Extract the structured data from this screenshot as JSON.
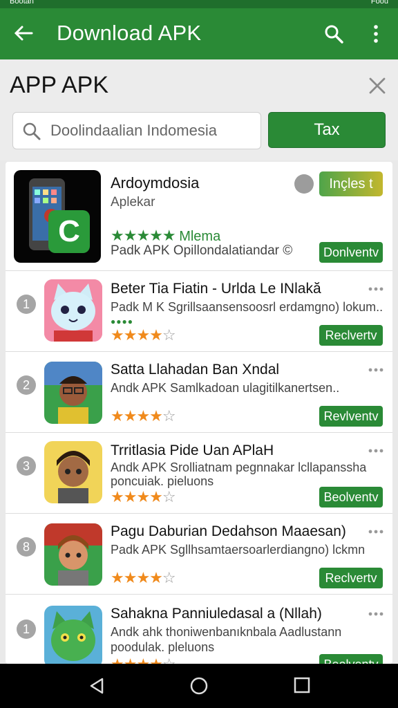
{
  "statusbar": {
    "left": "Bootan",
    "right": "Foou"
  },
  "appbar": {
    "title": "Download APK"
  },
  "header": {
    "title": "APP APK"
  },
  "search": {
    "placeholder": "Doolindaalian Indomesia",
    "button_label": "Tax"
  },
  "featured": {
    "name": "Ardoymdosia",
    "developer": "Aplekar",
    "rating_label": "Mlema",
    "stars": "★★★★★",
    "description": "Padk APK Opillondalatiandar ©",
    "install_label": "Inçles t",
    "download_label": "Donlventv"
  },
  "apps": [
    {
      "rank": "1",
      "name": "Beter Tia Fiatin - Urlda Le INlakă",
      "desc1": "Padk M K Sgrillsaansensoosrl erdamgno) lokum..",
      "desc2": "",
      "rating": 4,
      "button": "Reclvertv"
    },
    {
      "rank": "2",
      "name": "Satta Llahadan Ban Xndal",
      "desc1": "Andk APK Samlkadoan ulagitilkanertsen..",
      "desc2": "",
      "rating": 4,
      "button": "Revlventv"
    },
    {
      "rank": "3",
      "name": "Trritlasia Pide Uan APlaH",
      "desc1": "Andk APK Srolliatnam pegnnakar lcllapanssha",
      "desc2": "poncuiak. pieluons",
      "rating": 4,
      "button": "Beolventv"
    },
    {
      "rank": "8",
      "name": "Pagu Daburian Dedahson Maaesan)",
      "desc1": "Padk APK Sgllhsamtaersoarlerdiangno) lckmn",
      "desc2": "",
      "rating": 4,
      "button": "Reclvertv"
    },
    {
      "rank": "1",
      "name": "Sahakna Panniuledasal a (Nllah)",
      "desc1": "Andk ahk thoniwenbanıknbala Aadlustann",
      "desc2": "poodulak. pleluons",
      "rating": 4,
      "button": "Beolventv"
    }
  ],
  "icons": [
    "arrow-back",
    "search",
    "more-vert",
    "close",
    "back-triangle",
    "home-circle",
    "recents-square"
  ],
  "colors": {
    "primary": "#2a8a36",
    "star": "#f08a1c"
  }
}
